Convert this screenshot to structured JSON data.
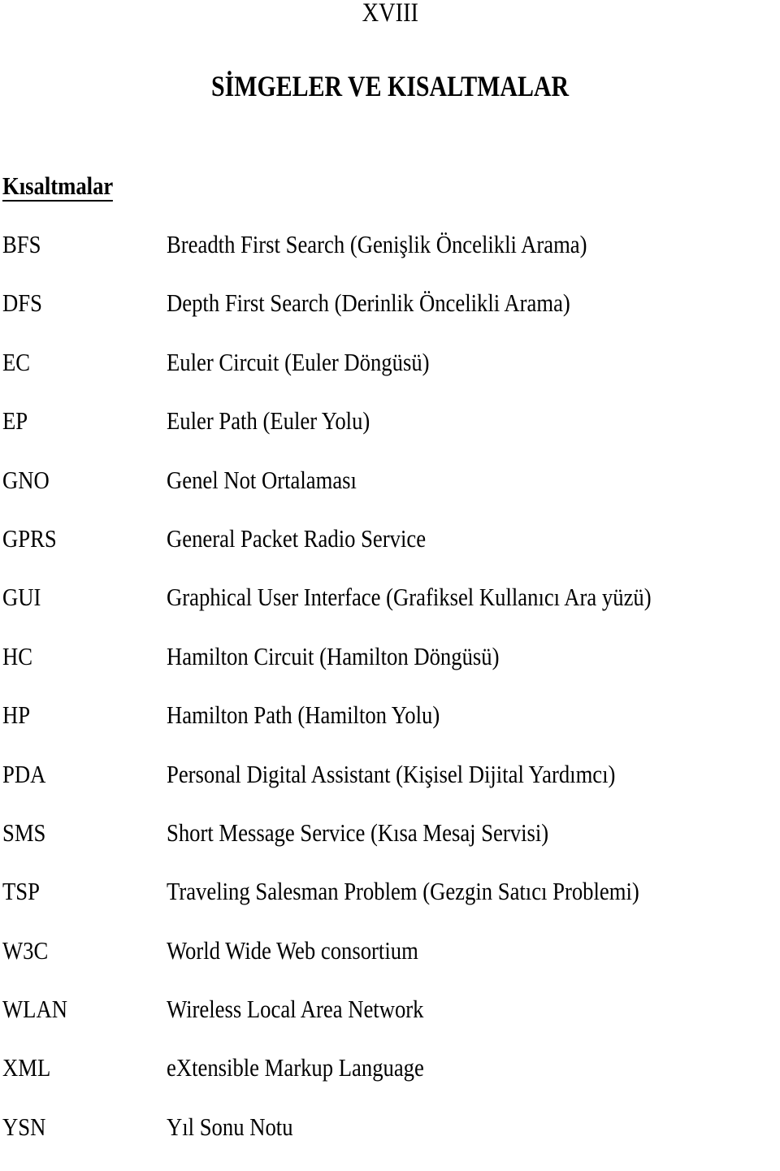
{
  "page": {
    "number": "XVIII",
    "title": "SİMGELER VE KISALTMALAR"
  },
  "section": {
    "heading": "Kısaltmalar",
    "items": [
      {
        "abbr": "BFS",
        "definition": "Breadth First Search (Genişlik Öncelikli Arama)"
      },
      {
        "abbr": "DFS",
        "definition": "Depth First Search (Derinlik Öncelikli Arama)"
      },
      {
        "abbr": "EC",
        "definition": "Euler Circuit (Euler Döngüsü)"
      },
      {
        "abbr": "EP",
        "definition": "Euler Path (Euler Yolu)"
      },
      {
        "abbr": "GNO",
        "definition": "Genel Not Ortalaması"
      },
      {
        "abbr": "GPRS",
        "definition": "General Packet Radio Service"
      },
      {
        "abbr": "GUI",
        "definition": "Graphical User Interface (Grafiksel Kullanıcı Ara yüzü)"
      },
      {
        "abbr": "HC",
        "definition": "Hamilton Circuit (Hamilton Döngüsü)"
      },
      {
        "abbr": "HP",
        "definition": "Hamilton Path (Hamilton Yolu)"
      },
      {
        "abbr": "PDA",
        "definition": "Personal Digital Assistant (Kişisel Dijital Yardımcı)"
      },
      {
        "abbr": "SMS",
        "definition": "Short Message Service (Kısa Mesaj Servisi)"
      },
      {
        "abbr": "TSP",
        "definition": "Traveling Salesman Problem (Gezgin Satıcı Problemi)"
      },
      {
        "abbr": "W3C",
        "definition": "World Wide Web consortium"
      },
      {
        "abbr": "WLAN",
        "definition": "Wireless Local Area Network"
      },
      {
        "abbr": "XML",
        "definition": "eXtensible Markup Language"
      },
      {
        "abbr": "YSN",
        "definition": "Yıl Sonu Notu"
      }
    ]
  }
}
